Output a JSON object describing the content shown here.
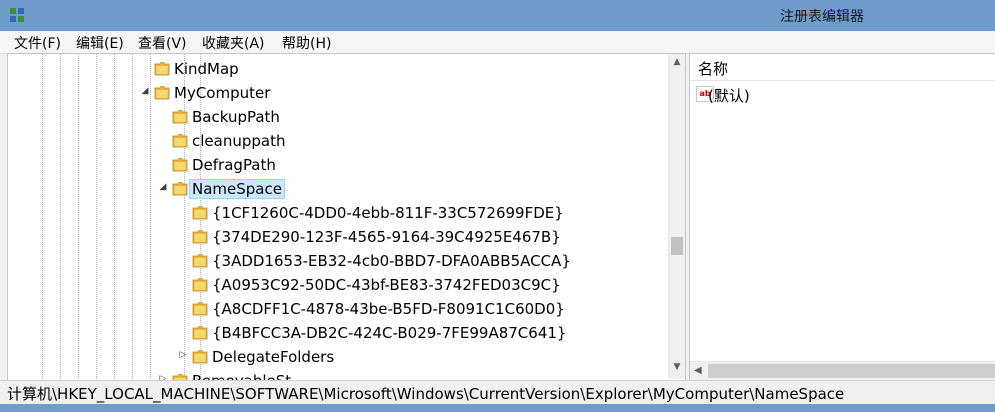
{
  "window": {
    "title": "注册表编辑器",
    "app_icon": "regedit-icon",
    "frame_color": "#6e9bc9"
  },
  "menu": [
    {
      "label": "文件(F)"
    },
    {
      "label": "编辑(E)"
    },
    {
      "label": "查看(V)"
    },
    {
      "label": "收藏夹(A)"
    },
    {
      "label": "帮助(H)"
    }
  ],
  "tree": {
    "folder_icon": "folder-icon",
    "selection_color": "#cce8ff",
    "nodes": [
      {
        "label": "KindMap",
        "expander": ""
      },
      {
        "label": "MyComputer",
        "expander": "expanded"
      },
      {
        "label": "BackupPath",
        "expander": ""
      },
      {
        "label": "cleanuppath",
        "expander": ""
      },
      {
        "label": "DefragPath",
        "expander": ""
      },
      {
        "label": "NameSpace",
        "expander": "expanded",
        "selected": true
      },
      {
        "label": "{1CF1260C-4DD0-4ebb-811F-33C572699FDE}",
        "expander": ""
      },
      {
        "label": "{374DE290-123F-4565-9164-39C4925E467B}",
        "expander": ""
      },
      {
        "label": "{3ADD1653-EB32-4cb0-BBD7-DFA0ABB5ACCA}",
        "expander": ""
      },
      {
        "label": "{A0953C92-50DC-43bf-BE83-3742FED03C9C}",
        "expander": ""
      },
      {
        "label": "{A8CDFF1C-4878-43be-B5FD-F8091C1C60D0}",
        "expander": ""
      },
      {
        "label": "{B4BFCC3A-DB2C-424C-B029-7FE99A87C641}",
        "expander": ""
      },
      {
        "label": "DelegateFolders",
        "expander": "collapsed"
      },
      {
        "label": "RemovableSt...",
        "expander": "collapsed"
      }
    ]
  },
  "values": {
    "header_name": "名称",
    "rows": [
      {
        "name": "(默认)",
        "icon": "string-value-icon"
      }
    ]
  },
  "status": {
    "path": "计算机\\HKEY_LOCAL_MACHINE\\SOFTWARE\\Microsoft\\Windows\\CurrentVersion\\Explorer\\MyComputer\\NameSpace"
  }
}
